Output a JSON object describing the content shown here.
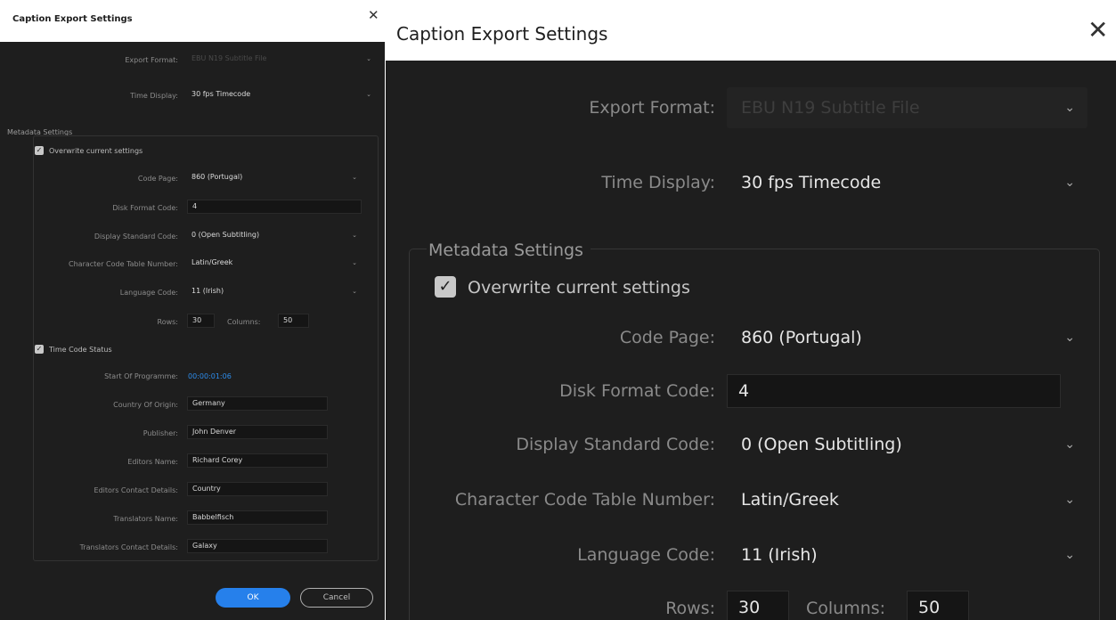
{
  "dialog": {
    "title": "Caption Export Settings",
    "close_glyph": "✕",
    "export_format": {
      "label": "Export Format:",
      "value": "EBU N19 Subtitle File",
      "disabled": true
    },
    "time_display": {
      "label": "Time Display:",
      "value": "30 fps Timecode"
    },
    "metadata": {
      "group_label": "Metadata Settings",
      "overwrite": {
        "label": "Overwrite current settings",
        "checked": true
      },
      "code_page": {
        "label": "Code Page:",
        "value": "860 (Portugal)"
      },
      "disk_format_code": {
        "label": "Disk Format Code:",
        "value": "4"
      },
      "display_standard_code": {
        "label": "Display Standard Code:",
        "value": "0 (Open Subtitling)"
      },
      "character_code_table": {
        "label": "Character Code Table Number:",
        "value": "Latin/Greek"
      },
      "language_code": {
        "label": "Language Code:",
        "value": "11 (Irish)"
      },
      "rows": {
        "label": "Rows:",
        "value": "30"
      },
      "columns": {
        "label": "Columns:",
        "value": "50"
      },
      "time_code_status": {
        "label": "Time Code Status",
        "checked": true
      },
      "start_of_programme": {
        "label": "Start Of Programme:",
        "value": "00:00:01:06"
      },
      "country_of_origin": {
        "label": "Country Of Origin:",
        "value": "Germany"
      },
      "publisher": {
        "label": "Publisher:",
        "value": "John Denver"
      },
      "editors_name": {
        "label": "Editors Name:",
        "value": "Richard Corey"
      },
      "editors_contact": {
        "label": "Editors Contact Details:",
        "value": "Country"
      },
      "translators_name": {
        "label": "Translators Name:",
        "value": "Babbelfisch"
      },
      "translators_contact": {
        "label": "Translators Contact Details:",
        "value": "Galaxy"
      }
    },
    "buttons": {
      "ok": "OK",
      "cancel": "Cancel"
    }
  },
  "icons": {
    "chevron": "chevron-down-icon",
    "check": "checkmark-icon",
    "close": "close-icon"
  },
  "colors": {
    "accent": "#2680eb",
    "timecode": "#2d8ceb",
    "panel": "#1e1e1e",
    "field": "#151515"
  }
}
